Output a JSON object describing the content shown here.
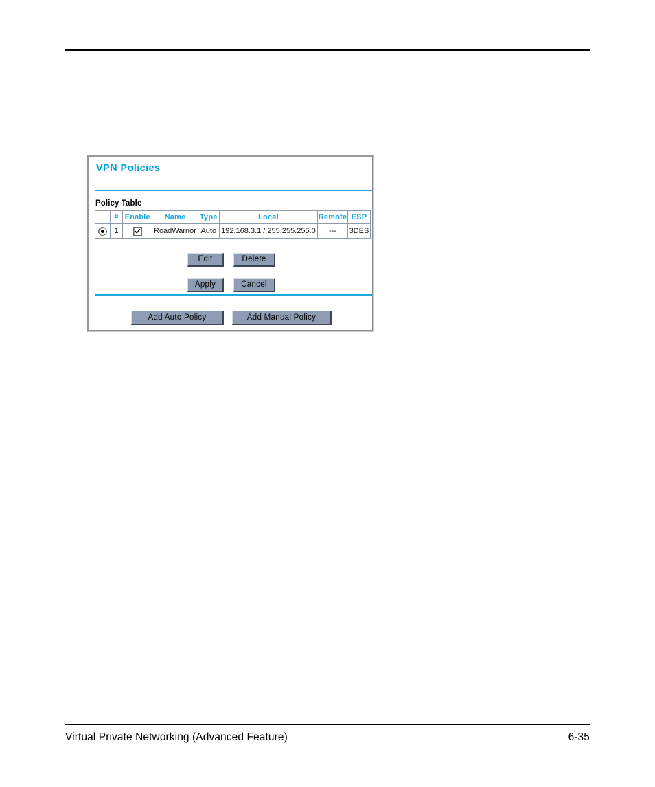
{
  "page": {
    "footer_title": "Virtual Private Networking (Advanced Feature)",
    "page_number": "6-35"
  },
  "panel": {
    "title": "VPN Policies",
    "section_label": "Policy Table",
    "accent_color": "#1BA8DD",
    "button_face_color": "#8E9CB4"
  },
  "table": {
    "headers": {
      "select": "",
      "num": "#",
      "enable": "Enable",
      "name": "Name",
      "type": "Type",
      "local": "Local",
      "remote": "Remote",
      "esp": "ESP"
    },
    "rows": [
      {
        "selected": true,
        "num": "1",
        "enabled": true,
        "name": "RoadWarrior",
        "type": "Auto",
        "local": "192.168.3.1 / 255.255.255.0",
        "remote": "---",
        "esp": "3DES"
      }
    ]
  },
  "buttons": {
    "edit": "Edit",
    "delete": "Delete",
    "apply": "Apply",
    "cancel": "Cancel",
    "add_auto_policy": "Add Auto Policy",
    "add_manual_policy": "Add Manual Policy"
  }
}
